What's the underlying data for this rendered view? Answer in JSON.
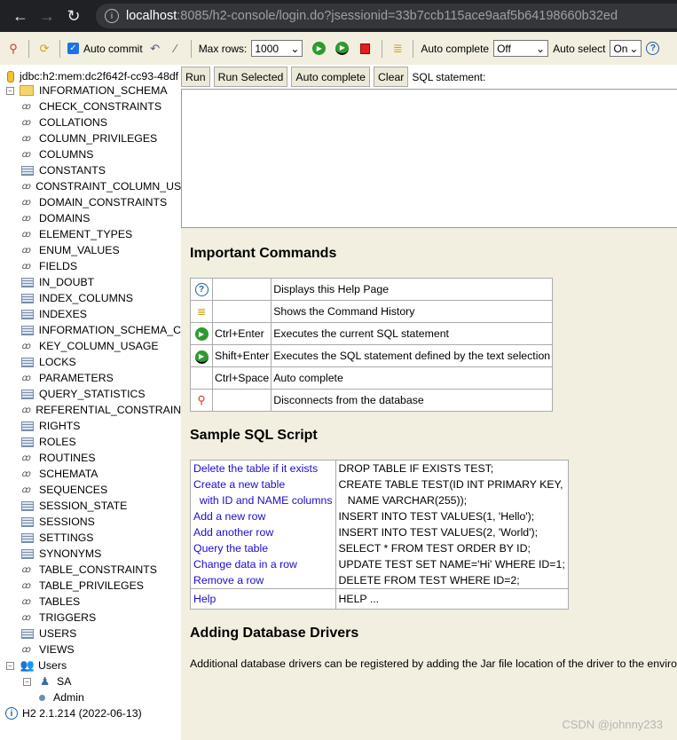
{
  "browser": {
    "host": "localhost",
    "url_rest": ":8085/h2-console/login.do?jsessionid=33b7ccb115ace9aaf5b64198660b32ed"
  },
  "toolbar": {
    "auto_commit": "Auto commit",
    "max_rows_label": "Max rows:",
    "max_rows": "1000",
    "auto_complete_label": "Auto complete",
    "auto_complete": "Off",
    "auto_select_label": "Auto select",
    "auto_select": "On"
  },
  "connection": "jdbc:h2:mem:dc2f642f-cc93-48df",
  "schema": "INFORMATION_SCHEMA",
  "tables": [
    {
      "name": "CHECK_CONSTRAINTS",
      "type": "view"
    },
    {
      "name": "COLLATIONS",
      "type": "view"
    },
    {
      "name": "COLUMN_PRIVILEGES",
      "type": "view"
    },
    {
      "name": "COLUMNS",
      "type": "view"
    },
    {
      "name": "CONSTANTS",
      "type": "table"
    },
    {
      "name": "CONSTRAINT_COLUMN_US",
      "type": "view"
    },
    {
      "name": "DOMAIN_CONSTRAINTS",
      "type": "view"
    },
    {
      "name": "DOMAINS",
      "type": "view"
    },
    {
      "name": "ELEMENT_TYPES",
      "type": "view"
    },
    {
      "name": "ENUM_VALUES",
      "type": "view"
    },
    {
      "name": "FIELDS",
      "type": "view"
    },
    {
      "name": "IN_DOUBT",
      "type": "table"
    },
    {
      "name": "INDEX_COLUMNS",
      "type": "table"
    },
    {
      "name": "INDEXES",
      "type": "table"
    },
    {
      "name": "INFORMATION_SCHEMA_C",
      "type": "table"
    },
    {
      "name": "KEY_COLUMN_USAGE",
      "type": "view"
    },
    {
      "name": "LOCKS",
      "type": "table"
    },
    {
      "name": "PARAMETERS",
      "type": "view"
    },
    {
      "name": "QUERY_STATISTICS",
      "type": "table"
    },
    {
      "name": "REFERENTIAL_CONSTRAIN",
      "type": "view"
    },
    {
      "name": "RIGHTS",
      "type": "table"
    },
    {
      "name": "ROLES",
      "type": "table"
    },
    {
      "name": "ROUTINES",
      "type": "view"
    },
    {
      "name": "SCHEMATA",
      "type": "view"
    },
    {
      "name": "SEQUENCES",
      "type": "view"
    },
    {
      "name": "SESSION_STATE",
      "type": "table"
    },
    {
      "name": "SESSIONS",
      "type": "table"
    },
    {
      "name": "SETTINGS",
      "type": "table"
    },
    {
      "name": "SYNONYMS",
      "type": "table"
    },
    {
      "name": "TABLE_CONSTRAINTS",
      "type": "view"
    },
    {
      "name": "TABLE_PRIVILEGES",
      "type": "view"
    },
    {
      "name": "TABLES",
      "type": "view"
    },
    {
      "name": "TRIGGERS",
      "type": "view"
    },
    {
      "name": "USERS",
      "type": "table"
    },
    {
      "name": "VIEWS",
      "type": "view"
    }
  ],
  "users": {
    "label": "Users",
    "user": "SA",
    "role": "Admin"
  },
  "version": "H2 2.1.214 (2022-06-13)",
  "query": {
    "run": "Run",
    "run_selected": "Run Selected",
    "auto_complete": "Auto complete",
    "clear": "Clear",
    "label": "SQL statement:"
  },
  "help": {
    "commands_title": "Important Commands",
    "commands": [
      {
        "icon": "help-icon",
        "key": "",
        "desc": "Displays this Help Page"
      },
      {
        "icon": "history-icon",
        "key": "",
        "desc": "Shows the Command History"
      },
      {
        "icon": "run-icon",
        "key": "Ctrl+Enter",
        "desc": "Executes the current SQL statement"
      },
      {
        "icon": "run-selected-icon",
        "key": "Shift+Enter",
        "desc": "Executes the SQL statement defined by the text selection"
      },
      {
        "icon": "",
        "key": "Ctrl+Space",
        "desc": "Auto complete"
      },
      {
        "icon": "disconnect-icon",
        "key": "",
        "desc": "Disconnects from the database"
      }
    ],
    "sample_title": "Sample SQL Script",
    "sample": [
      {
        "label": "Delete the table if it exists",
        "sql": "DROP TABLE IF EXISTS TEST;"
      },
      {
        "label": "Create a new table",
        "sql": "CREATE TABLE TEST(ID INT PRIMARY KEY,"
      },
      {
        "label": "  with ID and NAME columns",
        "sql": "   NAME VARCHAR(255));"
      },
      {
        "label": "Add a new row",
        "sql": "INSERT INTO TEST VALUES(1, 'Hello');"
      },
      {
        "label": "Add another row",
        "sql": "INSERT INTO TEST VALUES(2, 'World');"
      },
      {
        "label": "Query the table",
        "sql": "SELECT * FROM TEST ORDER BY ID;"
      },
      {
        "label": "Change data in a row",
        "sql": "UPDATE TEST SET NAME='Hi' WHERE ID=1;"
      },
      {
        "label": "Remove a row",
        "sql": "DELETE FROM TEST WHERE ID=2;"
      }
    ],
    "help_row": {
      "label": "Help",
      "sql": "HELP ..."
    },
    "drivers_title": "Adding Database Drivers",
    "drivers_text": "Additional database drivers can be registered by adding the Jar file location of the driver to the environment"
  },
  "watermark": "CSDN @johnny233"
}
